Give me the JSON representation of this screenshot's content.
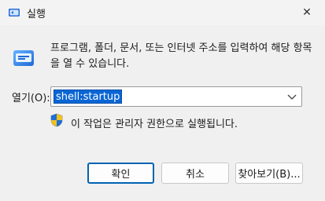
{
  "window": {
    "title": "실행",
    "app_icon": "run-icon",
    "close_label": "✕"
  },
  "description": "프로그램, 폴더, 문서, 또는 인터넷 주소를 입력하여 해당 항목을 열 수 있습니다.",
  "open": {
    "label": "열기(O):",
    "value": "shell:startup"
  },
  "admin_note": "이 작업은 관리자 권한으로 실행됩니다.",
  "buttons": {
    "ok": "확인",
    "cancel": "취소",
    "browse": "찾아보기(B)..."
  },
  "colors": {
    "selection": "#0a66d4",
    "primary_border": "#0063b1"
  }
}
